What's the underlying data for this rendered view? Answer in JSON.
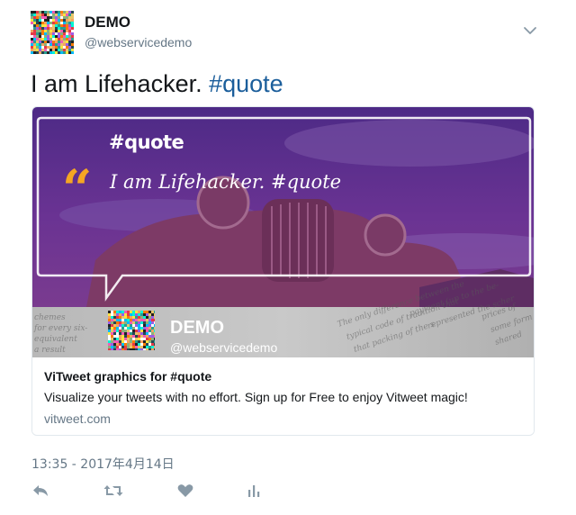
{
  "tweet": {
    "display_name": "DEMO",
    "handle": "@webservicedemo",
    "text_plain": "I am Lifehacker. ",
    "text_hashtag": "#quote",
    "timestamp": "13:35 - 2017年4月14日"
  },
  "card": {
    "image": {
      "bubble_title": "#quote",
      "quote_mark": "“",
      "quote_text": "I am Lifehacker. #quote",
      "author_name": "DEMO",
      "author_handle": "@webservicedemo"
    },
    "title": "ViTweet graphics for #quote",
    "description": "Visualize your tweets with no effort. Sign up for Free to enjoy Vitweet magic!",
    "domain": "vitweet.com"
  },
  "icons": [
    "chevron-down-icon",
    "reply-icon",
    "retweet-icon",
    "like-icon",
    "analytics-icon"
  ],
  "colors": {
    "hashtag": "#1b5e9b",
    "quote_mark": "#f5a623",
    "muted": "#657786",
    "image_purple": "#5a2a86"
  }
}
